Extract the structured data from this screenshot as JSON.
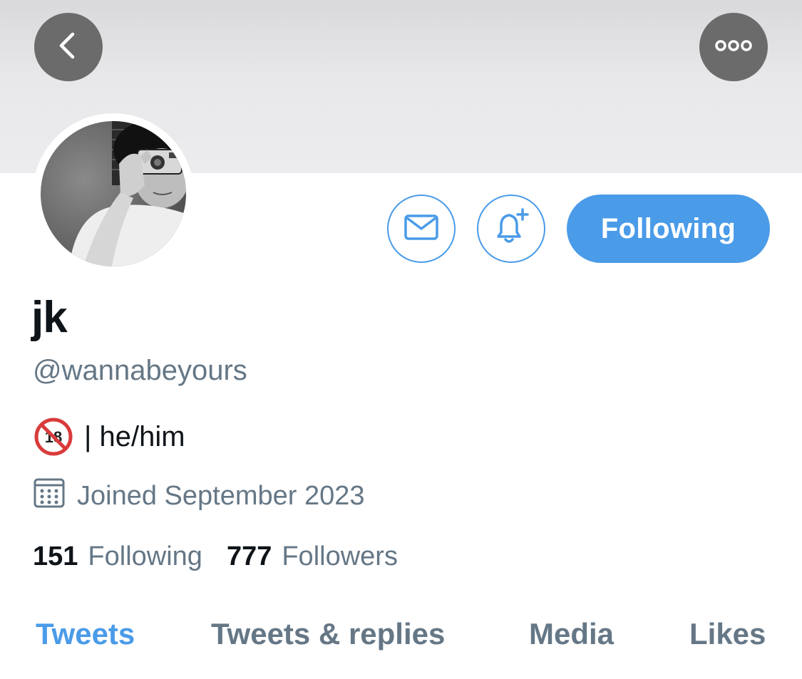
{
  "profile": {
    "display_name": "jk",
    "handle": "@wannabeyours",
    "bio": "| he/him",
    "joined": "Joined September 2023"
  },
  "actions": {
    "follow_label": "Following"
  },
  "stats": {
    "following_count": "151",
    "following_label": "Following",
    "followers_count": "777",
    "followers_label": "Followers"
  },
  "tabs": [
    {
      "label": "Tweets",
      "active": true
    },
    {
      "label": "Tweets & replies",
      "active": false
    },
    {
      "label": "Media",
      "active": false
    },
    {
      "label": "Likes",
      "active": false
    }
  ],
  "icons": {
    "back": "chevron-left-icon",
    "more": "more-icon",
    "message": "mail-icon",
    "notify": "bell-plus-icon",
    "calendar": "calendar-icon",
    "bio_emoji": "no-one-under-eighteen-icon"
  },
  "colors": {
    "accent": "#4a9be8",
    "secondary_text": "#657786",
    "primary_text": "#0f1419",
    "overlay_button": "#6b6b6b"
  }
}
